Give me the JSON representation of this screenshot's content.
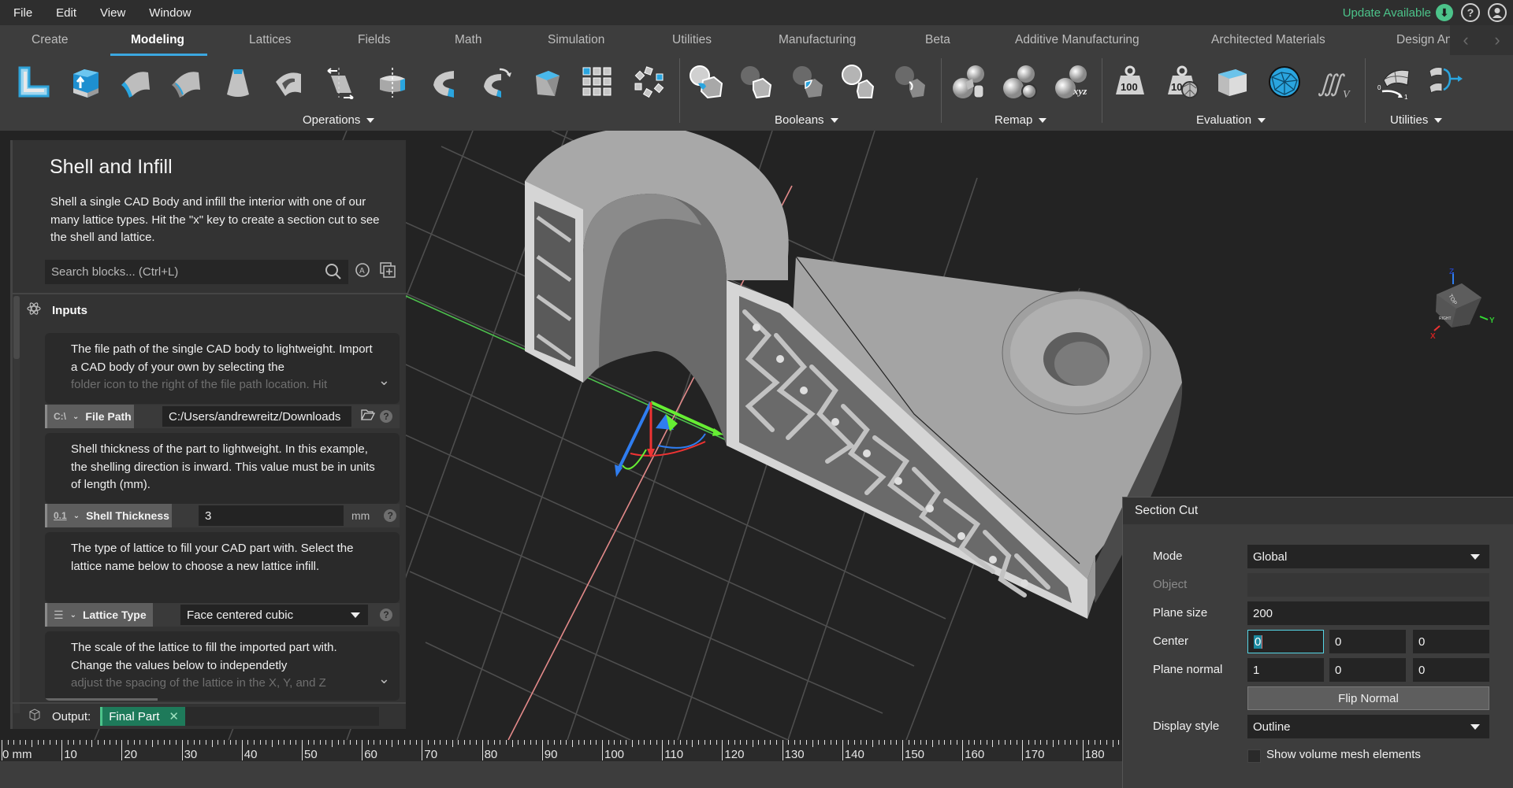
{
  "menu": [
    "File",
    "Edit",
    "View",
    "Window"
  ],
  "status": {
    "update_label": "Update Available",
    "help_icon": "help-icon",
    "account_icon": "account-icon"
  },
  "tabs": [
    {
      "label": "Create",
      "active": false
    },
    {
      "label": "Modeling",
      "active": true
    },
    {
      "label": "Lattices",
      "active": false
    },
    {
      "label": "Fields",
      "active": false
    },
    {
      "label": "Math",
      "active": false
    },
    {
      "label": "Simulation",
      "active": false
    },
    {
      "label": "Utilities",
      "active": false
    },
    {
      "label": "Manufacturing",
      "active": false
    },
    {
      "label": "Beta",
      "active": false
    },
    {
      "label": "Additive Manufacturing",
      "active": false
    },
    {
      "label": "Architected Materials",
      "active": false
    },
    {
      "label": "Design An",
      "active": false
    }
  ],
  "tab_nav": {
    "prev": "‹",
    "next": "›"
  },
  "toolbar_groups": [
    {
      "label": "Operations",
      "tools": [
        "offset-body-icon",
        "extrude-icon",
        "fillet-icon",
        "double-fillet-icon",
        "draft-icon",
        "shell-icon",
        "shear-icon",
        "split-icon",
        "revolve-icon",
        "sweep-icon",
        "chamfer-icon",
        "pattern-grid-icon",
        "pattern-circular-icon"
      ]
    },
    {
      "label": "Booleans",
      "tools": [
        "boolean-union-icon",
        "boolean-subtract-icon",
        "boolean-intersect-icon",
        "boolean-subtract-outline-icon",
        "boolean-difference-icon"
      ]
    },
    {
      "label": "Remap",
      "tools": [
        "remap-cylindrical-icon",
        "remap-spherical-icon",
        "remap-xyz-icon"
      ]
    },
    {
      "label": "Evaluation",
      "tools": [
        "mass-properties-icon",
        "mesh-mass-icon",
        "bounding-box-icon",
        "mesh-sphere-icon",
        "volume-integral-icon"
      ]
    },
    {
      "label": "Utilities",
      "tools": [
        "surface-parameter-icon",
        "surface-merge-icon"
      ]
    }
  ],
  "panel": {
    "title": "Shell and Infill",
    "description": "Shell a single CAD Body and infill the interior with one of our many lattice types. Hit the \"x\" key to create a section cut to see the shell and lattice.",
    "search_placeholder": "Search blocks... (Ctrl+L)",
    "inputs_label": "Inputs",
    "cards": [
      {
        "text": "The file path of the single CAD body to lightweight. Import a CAD body of your own by selecting the",
        "text_faded": "folder icon to the right of the file path location. Hit",
        "type_tag": "C:\\",
        "label": "File Path",
        "value": "C:/Users/andrewreitz/Downloads"
      },
      {
        "text": "Shell thickness of the part to lightweight. In this example, the shelling direction is inward. This value must be in units of length (mm).",
        "type_tag": "0.1",
        "label": "Shell Thickness",
        "value": "3",
        "unit": "mm"
      },
      {
        "text": "The type of lattice to fill your CAD part with. Select the lattice name below to choose a new lattice infill.",
        "type_tag": "☰",
        "label": "Lattice Type",
        "value": "Face centered cubic"
      },
      {
        "text": "The scale of the lattice to fill the imported part with. Change the values below to independetly",
        "text_faded": "adjust the spacing of the lattice in the X, Y, and Z"
      }
    ],
    "output_label": "Output:",
    "output_value": "Final Part"
  },
  "viewcube": {
    "top": "TOP",
    "right": "RIGHT",
    "axis_x": "X",
    "axis_y": "Y",
    "axis_z": "Z"
  },
  "ruler": {
    "unit_label": "0 mm",
    "labels": [
      "10",
      "20",
      "30",
      "40",
      "50",
      "60",
      "70",
      "80",
      "90",
      "100",
      "110",
      "120",
      "130",
      "140",
      "150",
      "160",
      "170",
      "180"
    ]
  },
  "section_cut": {
    "title": "Section Cut",
    "mode_label": "Mode",
    "mode_value": "Global",
    "object_label": "Object",
    "object_value": "",
    "plane_size_label": "Plane size",
    "plane_size_value": "200",
    "center_label": "Center",
    "center": [
      "0",
      "0",
      "0"
    ],
    "normal_label": "Plane normal",
    "normal": [
      "1",
      "0",
      "0"
    ],
    "flip_label": "Flip Normal",
    "display_label": "Display style",
    "display_value": "Outline",
    "mesh_checkbox_label": "Show volume mesh elements",
    "mesh_checkbox_checked": false
  },
  "colors": {
    "accent": "#3ba7e0",
    "update_green": "#4cc38a",
    "output_chip": "#1e7a5a"
  }
}
